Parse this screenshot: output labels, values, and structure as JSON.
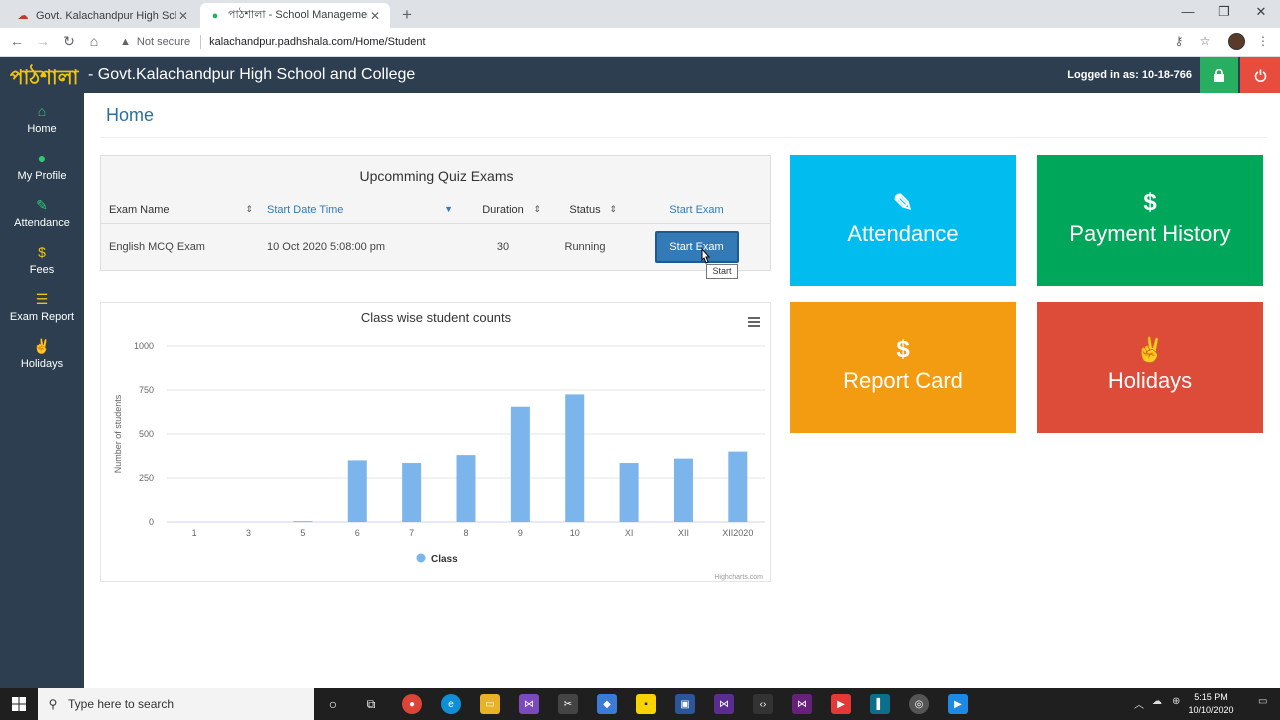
{
  "browser": {
    "tabs": [
      {
        "title": "Govt. Kalachandpur High School",
        "active": false
      },
      {
        "title": "পাঠশালা - School Management S",
        "active": true
      }
    ],
    "security_label": "Not secure",
    "url": "kalachandpur.padhshala.com/Home/Student"
  },
  "header": {
    "brand": "পাঠশালা",
    "school_name": "- Govt.Kalachandpur High School and College",
    "logged_in": "Logged in as: 10-18-766"
  },
  "sidebar": {
    "items": [
      {
        "label": "Home",
        "icon": "home-icon"
      },
      {
        "label": "My Profile",
        "icon": "user-icon"
      },
      {
        "label": "Attendance",
        "icon": "edit-icon"
      },
      {
        "label": "Fees",
        "icon": "dollar-icon"
      },
      {
        "label": "Exam Report",
        "icon": "list-icon"
      },
      {
        "label": "Holidays",
        "icon": "peace-icon"
      }
    ]
  },
  "main": {
    "page_title": "Home",
    "quiz": {
      "title": "Upcomming Quiz Exams",
      "columns": [
        "Exam Name",
        "Start Date Time",
        "Duration",
        "Status",
        "Start Exam"
      ],
      "rows": [
        {
          "name": "English MCQ Exam",
          "start": "10 Oct 2020 5:08:00 pm",
          "duration": "30",
          "status": "Running",
          "button": "Start Exam"
        }
      ],
      "tooltip": "Start"
    },
    "tiles": [
      {
        "label": "Attendance",
        "icon": "edit-icon",
        "color": "#00bcef"
      },
      {
        "label": "Payment History",
        "icon": "dollar-icon",
        "color": "#00a65a"
      },
      {
        "label": "Report Card",
        "icon": "dollar-icon",
        "color": "#f39c12"
      },
      {
        "label": "Holidays",
        "icon": "peace-icon",
        "color": "#dd4b39"
      }
    ]
  },
  "chart_data": {
    "type": "bar",
    "title": "Class wise student counts",
    "ylabel": "Number of students",
    "xlabel": "",
    "categories": [
      "1",
      "3",
      "5",
      "6",
      "7",
      "8",
      "9",
      "10",
      "XI",
      "XII",
      "XII2020"
    ],
    "series": [
      {
        "name": "Class",
        "values": [
          0,
          0,
          5,
          350,
          335,
          380,
          655,
          725,
          335,
          360,
          400
        ],
        "color": "#7cb5ec"
      }
    ],
    "yticks": [
      "0",
      "250",
      "500",
      "750",
      "1000"
    ],
    "ylim": [
      0,
      1000
    ],
    "legend": "bottom-center",
    "credits": "Highcharts.com"
  },
  "taskbar": {
    "search_placeholder": "Type here to search",
    "time": "5:15 PM",
    "date": "10/10/2020"
  }
}
